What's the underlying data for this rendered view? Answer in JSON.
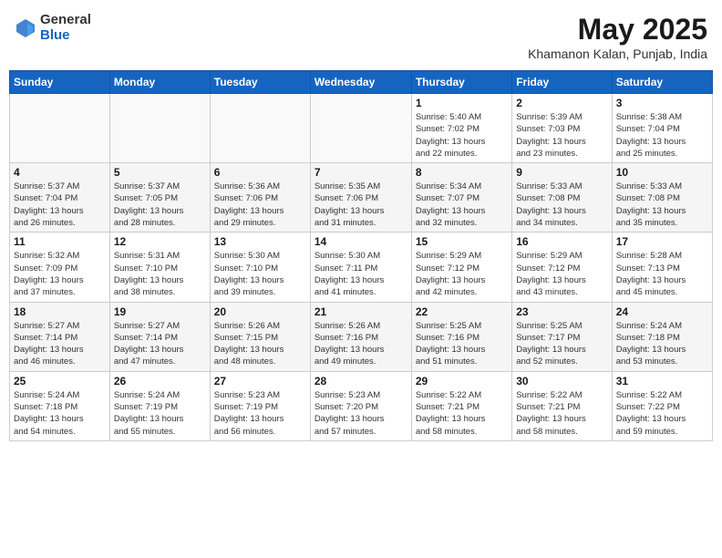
{
  "header": {
    "logo_general": "General",
    "logo_blue": "Blue",
    "month_title": "May 2025",
    "subtitle": "Khamanon Kalan, Punjab, India"
  },
  "weekdays": [
    "Sunday",
    "Monday",
    "Tuesday",
    "Wednesday",
    "Thursday",
    "Friday",
    "Saturday"
  ],
  "weeks": [
    [
      {
        "num": "",
        "info": ""
      },
      {
        "num": "",
        "info": ""
      },
      {
        "num": "",
        "info": ""
      },
      {
        "num": "",
        "info": ""
      },
      {
        "num": "1",
        "info": "Sunrise: 5:40 AM\nSunset: 7:02 PM\nDaylight: 13 hours\nand 22 minutes."
      },
      {
        "num": "2",
        "info": "Sunrise: 5:39 AM\nSunset: 7:03 PM\nDaylight: 13 hours\nand 23 minutes."
      },
      {
        "num": "3",
        "info": "Sunrise: 5:38 AM\nSunset: 7:04 PM\nDaylight: 13 hours\nand 25 minutes."
      }
    ],
    [
      {
        "num": "4",
        "info": "Sunrise: 5:37 AM\nSunset: 7:04 PM\nDaylight: 13 hours\nand 26 minutes."
      },
      {
        "num": "5",
        "info": "Sunrise: 5:37 AM\nSunset: 7:05 PM\nDaylight: 13 hours\nand 28 minutes."
      },
      {
        "num": "6",
        "info": "Sunrise: 5:36 AM\nSunset: 7:06 PM\nDaylight: 13 hours\nand 29 minutes."
      },
      {
        "num": "7",
        "info": "Sunrise: 5:35 AM\nSunset: 7:06 PM\nDaylight: 13 hours\nand 31 minutes."
      },
      {
        "num": "8",
        "info": "Sunrise: 5:34 AM\nSunset: 7:07 PM\nDaylight: 13 hours\nand 32 minutes."
      },
      {
        "num": "9",
        "info": "Sunrise: 5:33 AM\nSunset: 7:08 PM\nDaylight: 13 hours\nand 34 minutes."
      },
      {
        "num": "10",
        "info": "Sunrise: 5:33 AM\nSunset: 7:08 PM\nDaylight: 13 hours\nand 35 minutes."
      }
    ],
    [
      {
        "num": "11",
        "info": "Sunrise: 5:32 AM\nSunset: 7:09 PM\nDaylight: 13 hours\nand 37 minutes."
      },
      {
        "num": "12",
        "info": "Sunrise: 5:31 AM\nSunset: 7:10 PM\nDaylight: 13 hours\nand 38 minutes."
      },
      {
        "num": "13",
        "info": "Sunrise: 5:30 AM\nSunset: 7:10 PM\nDaylight: 13 hours\nand 39 minutes."
      },
      {
        "num": "14",
        "info": "Sunrise: 5:30 AM\nSunset: 7:11 PM\nDaylight: 13 hours\nand 41 minutes."
      },
      {
        "num": "15",
        "info": "Sunrise: 5:29 AM\nSunset: 7:12 PM\nDaylight: 13 hours\nand 42 minutes."
      },
      {
        "num": "16",
        "info": "Sunrise: 5:29 AM\nSunset: 7:12 PM\nDaylight: 13 hours\nand 43 minutes."
      },
      {
        "num": "17",
        "info": "Sunrise: 5:28 AM\nSunset: 7:13 PM\nDaylight: 13 hours\nand 45 minutes."
      }
    ],
    [
      {
        "num": "18",
        "info": "Sunrise: 5:27 AM\nSunset: 7:14 PM\nDaylight: 13 hours\nand 46 minutes."
      },
      {
        "num": "19",
        "info": "Sunrise: 5:27 AM\nSunset: 7:14 PM\nDaylight: 13 hours\nand 47 minutes."
      },
      {
        "num": "20",
        "info": "Sunrise: 5:26 AM\nSunset: 7:15 PM\nDaylight: 13 hours\nand 48 minutes."
      },
      {
        "num": "21",
        "info": "Sunrise: 5:26 AM\nSunset: 7:16 PM\nDaylight: 13 hours\nand 49 minutes."
      },
      {
        "num": "22",
        "info": "Sunrise: 5:25 AM\nSunset: 7:16 PM\nDaylight: 13 hours\nand 51 minutes."
      },
      {
        "num": "23",
        "info": "Sunrise: 5:25 AM\nSunset: 7:17 PM\nDaylight: 13 hours\nand 52 minutes."
      },
      {
        "num": "24",
        "info": "Sunrise: 5:24 AM\nSunset: 7:18 PM\nDaylight: 13 hours\nand 53 minutes."
      }
    ],
    [
      {
        "num": "25",
        "info": "Sunrise: 5:24 AM\nSunset: 7:18 PM\nDaylight: 13 hours\nand 54 minutes."
      },
      {
        "num": "26",
        "info": "Sunrise: 5:24 AM\nSunset: 7:19 PM\nDaylight: 13 hours\nand 55 minutes."
      },
      {
        "num": "27",
        "info": "Sunrise: 5:23 AM\nSunset: 7:19 PM\nDaylight: 13 hours\nand 56 minutes."
      },
      {
        "num": "28",
        "info": "Sunrise: 5:23 AM\nSunset: 7:20 PM\nDaylight: 13 hours\nand 57 minutes."
      },
      {
        "num": "29",
        "info": "Sunrise: 5:22 AM\nSunset: 7:21 PM\nDaylight: 13 hours\nand 58 minutes."
      },
      {
        "num": "30",
        "info": "Sunrise: 5:22 AM\nSunset: 7:21 PM\nDaylight: 13 hours\nand 58 minutes."
      },
      {
        "num": "31",
        "info": "Sunrise: 5:22 AM\nSunset: 7:22 PM\nDaylight: 13 hours\nand 59 minutes."
      }
    ]
  ]
}
